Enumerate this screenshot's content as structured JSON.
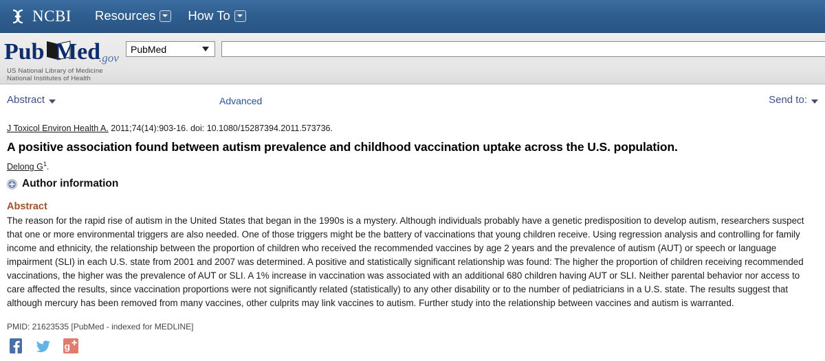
{
  "ncbi_bar": {
    "logo_text": "NCBI",
    "logo_icon": "dna-helix-icon",
    "nav": [
      {
        "label": "Resources",
        "icon": "chevron-down-box-icon"
      },
      {
        "label": "How To",
        "icon": "chevron-down-box-icon"
      }
    ]
  },
  "search_band": {
    "logo_alt": "PubMed.gov",
    "logo_word_pub": "Pub",
    "logo_word_med": "Med",
    "logo_word_gov": ".gov",
    "nlm_line1": "US National Library of Medicine",
    "nlm_line2": "National Institutes of Health",
    "database_selected": "PubMed",
    "database_options": [
      "PubMed"
    ],
    "search_value": "",
    "search_placeholder": "",
    "advanced_label": "Advanced"
  },
  "toolbar": {
    "display_format_label": "Abstract",
    "send_to_label": "Send to:"
  },
  "article": {
    "citation_journal": "J Toxicol Environ Health A.",
    "citation_rest": " 2011;74(14):903-16. doi: 10.1080/15287394.2011.573736.",
    "title": "A positive association found between autism prevalence and childhood vaccination uptake across the U.S. population.",
    "author_name": "Delong G",
    "author_affiliation_marker": "1",
    "author_trailing": ".",
    "author_information_label": "Author information",
    "abstract_heading": "Abstract",
    "abstract_text": "The reason for the rapid rise of autism in the United States that began in the 1990s is a mystery. Although individuals probably have a genetic predisposition to develop autism, researchers suspect that one or more environmental triggers are also needed. One of those triggers might be the battery of vaccinations that young children receive. Using regression analysis and controlling for family income and ethnicity, the relationship between the proportion of children who received the recommended vaccines by age 2 years and the prevalence of autism (AUT) or speech or language impairment (SLI) in each U.S. state from 2001 and 2007 was determined. A positive and statistically significant relationship was found: The higher the proportion of children receiving recommended vaccinations, the higher was the prevalence of AUT or SLI. A 1% increase in vaccination was associated with an additional 680 children having AUT or SLI. Neither parental behavior nor access to care affected the results, since vaccination proportions were not significantly related (statistically) to any other disability or to the number of pediatricians in a U.S. state. The results suggest that although mercury has been removed from many vaccines, other culprits may link vaccines to autism. Further study into the relationship between vaccines and autism is warranted.",
    "pmid_line": "PMID: 21623535 [PubMed - indexed for MEDLINE]"
  },
  "social": [
    {
      "name": "facebook-share-icon",
      "label": "Facebook"
    },
    {
      "name": "twitter-share-icon",
      "label": "Twitter"
    },
    {
      "name": "google-plus-share-icon",
      "label": "Google Plus"
    }
  ],
  "colors": {
    "header_blue": "#2d5c8d",
    "band_gray": "#e6e6e6",
    "link_blue": "#29538f",
    "abstract_heading_brown": "#a0522d",
    "facebook_blue": "#4a6ea9",
    "twitter_blue": "#62b4e4",
    "googleplus_red": "#e07b6e"
  }
}
